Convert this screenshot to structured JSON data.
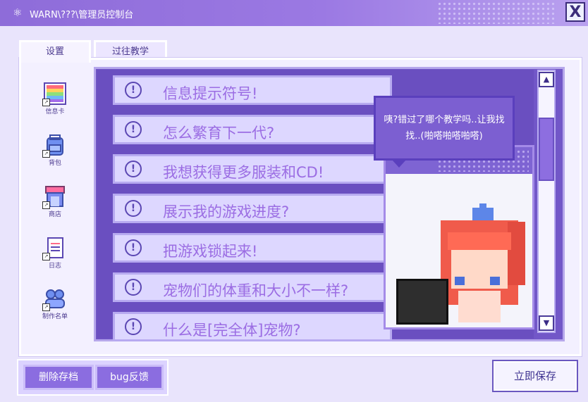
{
  "window": {
    "title": "WARN\\???\\管理员控制台",
    "close_label": "X"
  },
  "tabs": [
    {
      "label": "设置"
    },
    {
      "label": "过往教学"
    }
  ],
  "sidebar": {
    "items": [
      {
        "label": "信息卡",
        "icon": "rainbow-card-icon"
      },
      {
        "label": "背包",
        "icon": "backpack-icon"
      },
      {
        "label": "商店",
        "icon": "shop-icon"
      },
      {
        "label": "日志",
        "icon": "notebook-icon"
      },
      {
        "label": "制作名单",
        "icon": "credits-people-icon"
      }
    ]
  },
  "faq": {
    "items": [
      {
        "text": "信息提示符号!"
      },
      {
        "text": "怎么繁育下一代?"
      },
      {
        "text": "我想获得更多服装和CD!"
      },
      {
        "text": "展示我的游戏进度?"
      },
      {
        "text": "把游戏锁起来!"
      },
      {
        "text": "宠物们的体重和大小不一样?"
      },
      {
        "text": "什么是[完全体]宠物?"
      }
    ]
  },
  "speech_bubble": {
    "text": "咦?错过了哪个教学吗..让我找找..(啪嗒啪嗒啪嗒)"
  },
  "buttons": {
    "delete_save": "删除存档",
    "bug_report": "bug反馈",
    "save_now": "立即保存"
  },
  "colors": {
    "titlebar": "#8e6cd9",
    "list_bg": "#6a4fc0",
    "accent": "#8b6de0"
  }
}
